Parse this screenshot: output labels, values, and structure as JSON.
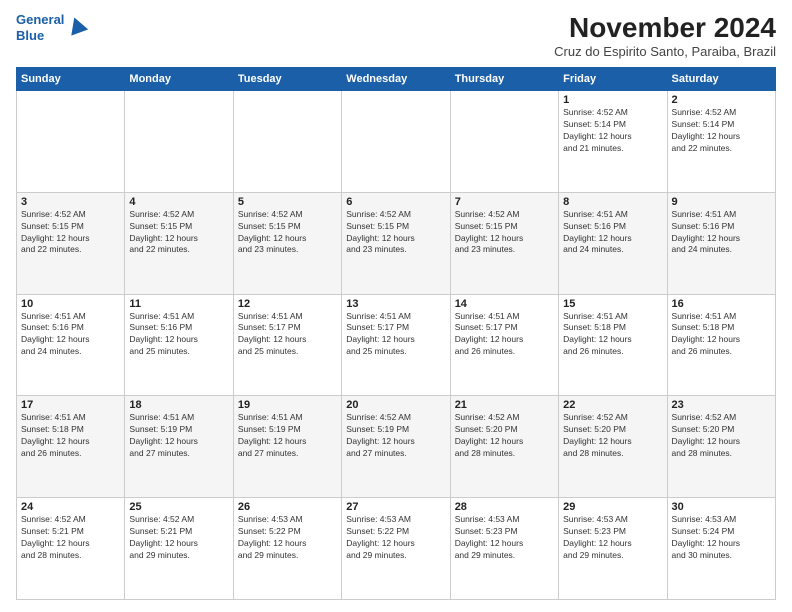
{
  "header": {
    "logo_line1": "General",
    "logo_line2": "Blue",
    "title": "November 2024",
    "subtitle": "Cruz do Espirito Santo, Paraiba, Brazil"
  },
  "days_of_week": [
    "Sunday",
    "Monday",
    "Tuesday",
    "Wednesday",
    "Thursday",
    "Friday",
    "Saturday"
  ],
  "weeks": [
    [
      {
        "day": "",
        "info": ""
      },
      {
        "day": "",
        "info": ""
      },
      {
        "day": "",
        "info": ""
      },
      {
        "day": "",
        "info": ""
      },
      {
        "day": "",
        "info": ""
      },
      {
        "day": "1",
        "info": "Sunrise: 4:52 AM\nSunset: 5:14 PM\nDaylight: 12 hours\nand 21 minutes."
      },
      {
        "day": "2",
        "info": "Sunrise: 4:52 AM\nSunset: 5:14 PM\nDaylight: 12 hours\nand 22 minutes."
      }
    ],
    [
      {
        "day": "3",
        "info": "Sunrise: 4:52 AM\nSunset: 5:15 PM\nDaylight: 12 hours\nand 22 minutes."
      },
      {
        "day": "4",
        "info": "Sunrise: 4:52 AM\nSunset: 5:15 PM\nDaylight: 12 hours\nand 22 minutes."
      },
      {
        "day": "5",
        "info": "Sunrise: 4:52 AM\nSunset: 5:15 PM\nDaylight: 12 hours\nand 23 minutes."
      },
      {
        "day": "6",
        "info": "Sunrise: 4:52 AM\nSunset: 5:15 PM\nDaylight: 12 hours\nand 23 minutes."
      },
      {
        "day": "7",
        "info": "Sunrise: 4:52 AM\nSunset: 5:15 PM\nDaylight: 12 hours\nand 23 minutes."
      },
      {
        "day": "8",
        "info": "Sunrise: 4:51 AM\nSunset: 5:16 PM\nDaylight: 12 hours\nand 24 minutes."
      },
      {
        "day": "9",
        "info": "Sunrise: 4:51 AM\nSunset: 5:16 PM\nDaylight: 12 hours\nand 24 minutes."
      }
    ],
    [
      {
        "day": "10",
        "info": "Sunrise: 4:51 AM\nSunset: 5:16 PM\nDaylight: 12 hours\nand 24 minutes."
      },
      {
        "day": "11",
        "info": "Sunrise: 4:51 AM\nSunset: 5:16 PM\nDaylight: 12 hours\nand 25 minutes."
      },
      {
        "day": "12",
        "info": "Sunrise: 4:51 AM\nSunset: 5:17 PM\nDaylight: 12 hours\nand 25 minutes."
      },
      {
        "day": "13",
        "info": "Sunrise: 4:51 AM\nSunset: 5:17 PM\nDaylight: 12 hours\nand 25 minutes."
      },
      {
        "day": "14",
        "info": "Sunrise: 4:51 AM\nSunset: 5:17 PM\nDaylight: 12 hours\nand 26 minutes."
      },
      {
        "day": "15",
        "info": "Sunrise: 4:51 AM\nSunset: 5:18 PM\nDaylight: 12 hours\nand 26 minutes."
      },
      {
        "day": "16",
        "info": "Sunrise: 4:51 AM\nSunset: 5:18 PM\nDaylight: 12 hours\nand 26 minutes."
      }
    ],
    [
      {
        "day": "17",
        "info": "Sunrise: 4:51 AM\nSunset: 5:18 PM\nDaylight: 12 hours\nand 26 minutes."
      },
      {
        "day": "18",
        "info": "Sunrise: 4:51 AM\nSunset: 5:19 PM\nDaylight: 12 hours\nand 27 minutes."
      },
      {
        "day": "19",
        "info": "Sunrise: 4:51 AM\nSunset: 5:19 PM\nDaylight: 12 hours\nand 27 minutes."
      },
      {
        "day": "20",
        "info": "Sunrise: 4:52 AM\nSunset: 5:19 PM\nDaylight: 12 hours\nand 27 minutes."
      },
      {
        "day": "21",
        "info": "Sunrise: 4:52 AM\nSunset: 5:20 PM\nDaylight: 12 hours\nand 28 minutes."
      },
      {
        "day": "22",
        "info": "Sunrise: 4:52 AM\nSunset: 5:20 PM\nDaylight: 12 hours\nand 28 minutes."
      },
      {
        "day": "23",
        "info": "Sunrise: 4:52 AM\nSunset: 5:20 PM\nDaylight: 12 hours\nand 28 minutes."
      }
    ],
    [
      {
        "day": "24",
        "info": "Sunrise: 4:52 AM\nSunset: 5:21 PM\nDaylight: 12 hours\nand 28 minutes."
      },
      {
        "day": "25",
        "info": "Sunrise: 4:52 AM\nSunset: 5:21 PM\nDaylight: 12 hours\nand 29 minutes."
      },
      {
        "day": "26",
        "info": "Sunrise: 4:53 AM\nSunset: 5:22 PM\nDaylight: 12 hours\nand 29 minutes."
      },
      {
        "day": "27",
        "info": "Sunrise: 4:53 AM\nSunset: 5:22 PM\nDaylight: 12 hours\nand 29 minutes."
      },
      {
        "day": "28",
        "info": "Sunrise: 4:53 AM\nSunset: 5:23 PM\nDaylight: 12 hours\nand 29 minutes."
      },
      {
        "day": "29",
        "info": "Sunrise: 4:53 AM\nSunset: 5:23 PM\nDaylight: 12 hours\nand 29 minutes."
      },
      {
        "day": "30",
        "info": "Sunrise: 4:53 AM\nSunset: 5:24 PM\nDaylight: 12 hours\nand 30 minutes."
      }
    ]
  ]
}
